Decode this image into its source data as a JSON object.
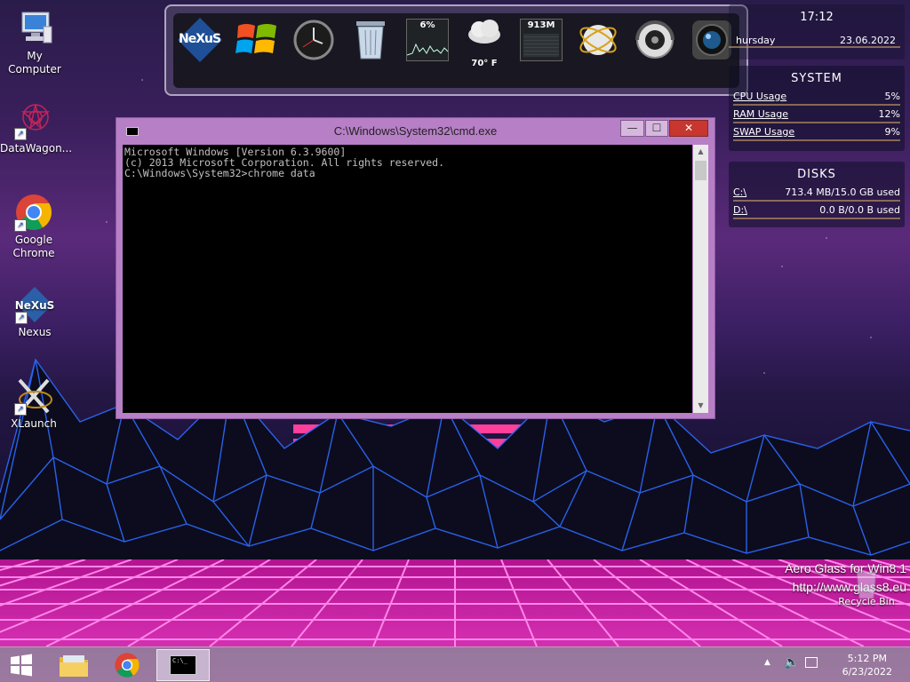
{
  "desktop_icons": [
    {
      "label": "My Computer"
    },
    {
      "label": "DataWagon..."
    },
    {
      "label": "Google Chrome"
    },
    {
      "label": "Nexus"
    },
    {
      "label": "XLaunch"
    }
  ],
  "dock": {
    "nexus_label": "NeXuS",
    "cpu_meter": "6%",
    "weather_temp": "70° F",
    "mem_meter": "913M"
  },
  "clock_widget": {
    "time": "17:12",
    "day": "hursday",
    "date": "23.06.2022"
  },
  "system_widget": {
    "title": "SYSTEM",
    "rows": [
      {
        "label": "CPU Usage",
        "value": "5%"
      },
      {
        "label": "RAM Usage",
        "value": "12%"
      },
      {
        "label": "SWAP Usage",
        "value": "9%"
      }
    ]
  },
  "disks_widget": {
    "title": "DISKS",
    "rows": [
      {
        "label": "C:\\",
        "value": "713.4 MB/15.0 GB used"
      },
      {
        "label": "D:\\",
        "value": "0.0 B/0.0 B used"
      }
    ]
  },
  "cmd_window": {
    "title": "C:\\Windows\\System32\\cmd.exe",
    "icon_text": "C:\\",
    "lines": [
      "Microsoft Windows [Version 6.3.9600]",
      "(c) 2013 Microsoft Corporation. All rights reserved.",
      "",
      "C:\\Windows\\System32>chrome data"
    ]
  },
  "watermark": {
    "line1": "Aero Glass for Win8.1",
    "line2": "http://www.glass8.eu"
  },
  "recycle_bin": {
    "label": "Recycle Bin"
  },
  "taskbar": {
    "time": "5:12 PM",
    "date": "6/23/2022",
    "cmd_icon_text": "C:\\_"
  }
}
